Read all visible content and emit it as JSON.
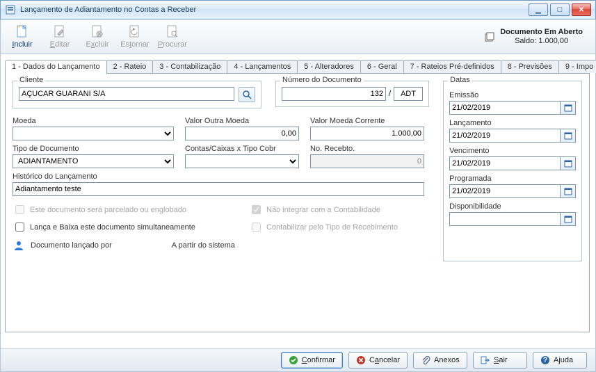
{
  "window": {
    "title": "Lançamento de Adiantamento no Contas a Receber"
  },
  "toolbar": {
    "incluir": "Incluir",
    "editar": "Editar",
    "excluir": "Excluir",
    "estornar": "Estornar",
    "procurar": "Procurar",
    "info_line1": "Documento Em Aberto",
    "info_line2": "Saldo: 1.000,00"
  },
  "tabs": [
    "1 - Dados do Lançamento",
    "2 - Rateio",
    "3 - Contabilização",
    "4 - Lançamentos",
    "5 - Alteradores",
    "6 - Geral",
    "7 - Rateios Pré-definidos",
    "8 - Previsões",
    "9 - Impo"
  ],
  "labels": {
    "cliente": "Cliente",
    "numero_doc": "Número do Documento",
    "moeda": "Moeda",
    "valor_outra": "Valor Outra Moeda",
    "valor_corr": "Valor Moeda Corrente",
    "tipo_doc": "Tipo de Documento",
    "contas_caixas": "Contas/Caixas x Tipo Cobr",
    "no_recebto": "No. Recebto.",
    "historico": "Histórico do Lançamento",
    "chk_parcelado": "Este documento será parcelado ou englobado",
    "chk_nao_integrar": "Não integrar com a Contabilidade",
    "chk_lanca_baixa": "Lança e Baixa este documento simultaneamente",
    "chk_contab_tipo": "Contabilizar pelo Tipo de Recebimento",
    "lancado_por": "Documento lançado por",
    "a_partir": "A partir do sistema",
    "datas": "Datas",
    "emissao": "Emissão",
    "lancamento": "Lançamento",
    "vencimento": "Vencimento",
    "programada": "Programada",
    "disponibilidade": "Disponibilidade"
  },
  "values": {
    "cliente": "AÇUCAR GUARANI S/A",
    "numero": "132",
    "numero_sep": "/",
    "numero_tipo": "ADT",
    "moeda": "",
    "valor_outra": "0,00",
    "valor_corr": "1.000,00",
    "tipo_doc": "ADIANTAMENTO",
    "contas_caixas": "",
    "no_recebto": "0",
    "historico": "Adiantamento teste",
    "lancado_por_user": "",
    "a_partir_sys": "",
    "emissao": "21/02/2019",
    "lancamento": "21/02/2019",
    "vencimento": "21/02/2019",
    "programada": "21/02/2019",
    "disponibilidade": ""
  },
  "footer": {
    "confirmar": "Confirmar",
    "cancelar": "Cancelar",
    "anexos": "Anexos",
    "sair": "Sair",
    "ajuda": "Ajuda"
  }
}
